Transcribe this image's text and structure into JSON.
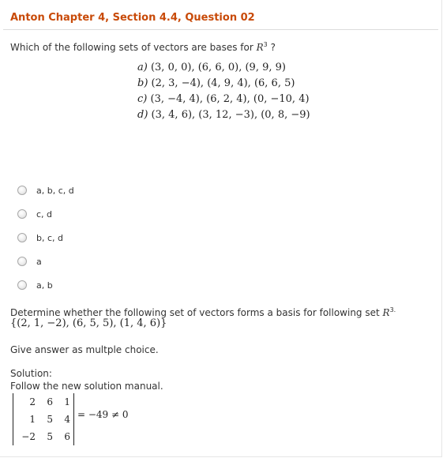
{
  "title": "Anton Chapter 4, Section 4.4, Question 02",
  "question": {
    "prefix": "Which of the following sets of vectors are bases for ",
    "space": "R",
    "exponent": "3",
    "suffix": " ?"
  },
  "vectors": [
    {
      "key": "a)",
      "text": "(3, 0, 0), (6, 6, 0), (9, 9, 9)"
    },
    {
      "key": "b)",
      "text": "(2, 3, −4), (4, 9, 4), (6, 6, 5)"
    },
    {
      "key": "c)",
      "text": "(3, −4, 4), (6, 2, 4), (0, −10, 4)"
    },
    {
      "key": "d)",
      "text": "(3, 4, 6), (3, 12, −3), (0, 8, −9)"
    }
  ],
  "options": [
    {
      "label": "a, b, c, d"
    },
    {
      "label": "c, d"
    },
    {
      "label": "b, c, d"
    },
    {
      "label": "a"
    },
    {
      "label": "a, b"
    }
  ],
  "determine": {
    "prefix": "Determine whether the following set of vectors forms a basis for following set ",
    "space": "R",
    "exponent": "3.",
    "set": "{(2, 1, −2), (6, 5, 5), (1, 4, 6)}"
  },
  "instruction": "Give answer as multple choice.",
  "solution": {
    "label": "Solution:",
    "note": "Follow the new solution manual.",
    "matrix": [
      [
        "2",
        "6",
        "1"
      ],
      [
        "1",
        "5",
        "4"
      ],
      [
        "−2",
        "5",
        "6"
      ]
    ],
    "result": "= −49 ≠ 0"
  }
}
